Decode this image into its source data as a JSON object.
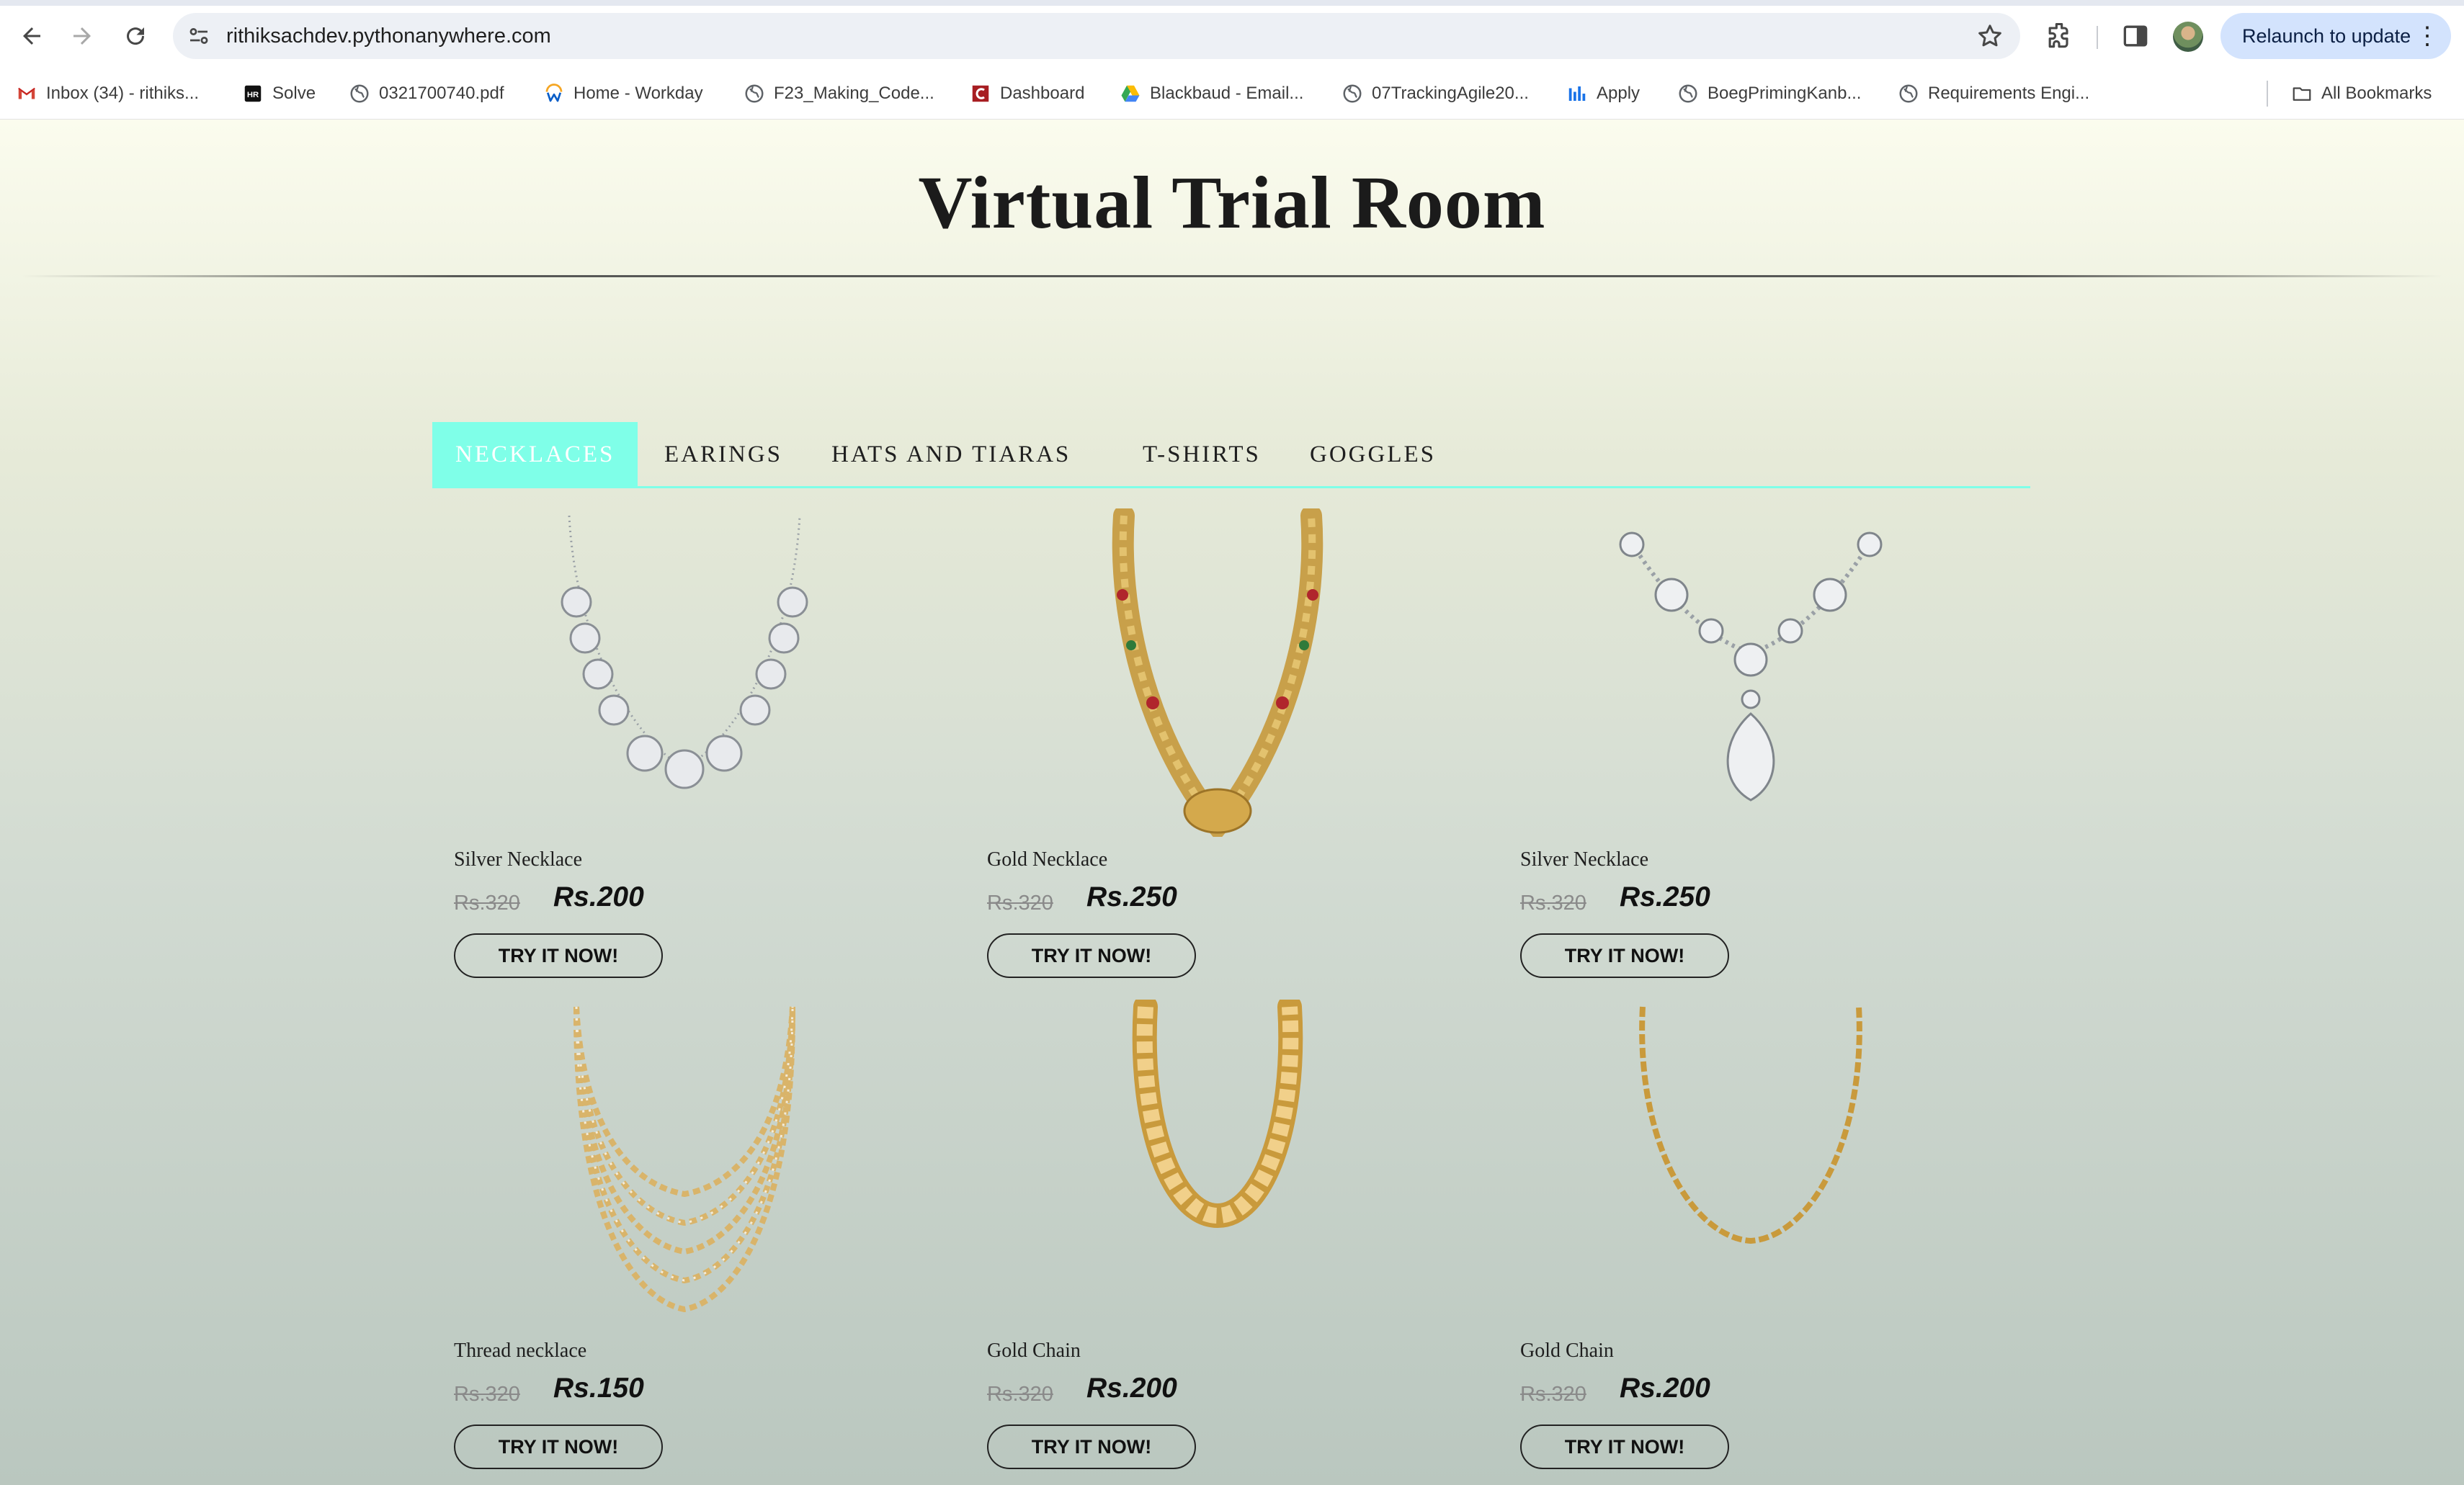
{
  "browser": {
    "url": "rithiksachdev.pythonanywhere.com",
    "relaunch_label": "Relaunch to update",
    "bookmarks": [
      {
        "label": "Inbox (34) - rithiks...",
        "icon": "gmail-icon"
      },
      {
        "label": "Solve",
        "icon": "solve-icon"
      },
      {
        "label": "0321700740.pdf",
        "icon": "globe-icon"
      },
      {
        "label": "Home - Workday",
        "icon": "workday-icon"
      },
      {
        "label": "F23_Making_Code...",
        "icon": "globe-icon"
      },
      {
        "label": "Dashboard",
        "icon": "dashboard-icon"
      },
      {
        "label": "Blackbaud - Email...",
        "icon": "drive-icon"
      },
      {
        "label": "07TrackingAgile20...",
        "icon": "globe-icon"
      },
      {
        "label": "Apply",
        "icon": "bar-chart-icon"
      },
      {
        "label": "BoegPrimingKanb...",
        "icon": "globe-icon"
      },
      {
        "label": "Requirements Engi...",
        "icon": "globe-icon"
      }
    ],
    "all_bookmarks_label": "All Bookmarks"
  },
  "page": {
    "title": "Virtual Trial Room",
    "tabs": [
      {
        "label": "NECKLACES",
        "active": true
      },
      {
        "label": "EARINGS",
        "active": false
      },
      {
        "label": "HATS AND TIARAS",
        "active": false
      },
      {
        "label": "T-SHIRTS",
        "active": false
      },
      {
        "label": "GOGGLES",
        "active": false
      }
    ],
    "products": [
      {
        "name": "Silver Necklace",
        "old_price": "Rs.320",
        "price": "Rs.200",
        "button": "TRY IT NOW!",
        "image": "silver-necklace-image"
      },
      {
        "name": "Gold Necklace",
        "old_price": "Rs.320",
        "price": "Rs.250",
        "button": "TRY IT NOW!",
        "image": "gold-necklace-image"
      },
      {
        "name": "Silver Necklace",
        "old_price": "Rs.320",
        "price": "Rs.250",
        "button": "TRY IT NOW!",
        "image": "diamond-pendant-necklace-image"
      },
      {
        "name": "Thread necklace",
        "old_price": "Rs.320",
        "price": "Rs.150",
        "button": "TRY IT NOW!",
        "image": "layered-thread-necklace-image"
      },
      {
        "name": "Gold Chain",
        "old_price": "Rs.320",
        "price": "Rs.200",
        "button": "TRY IT NOW!",
        "image": "cuban-gold-chain-image"
      },
      {
        "name": "Gold Chain",
        "old_price": "Rs.320",
        "price": "Rs.200",
        "button": "TRY IT NOW!",
        "image": "thin-gold-chain-image"
      }
    ]
  },
  "colors": {
    "tab_accent": "#7fffe8",
    "relaunch_bg": "#d3e3fd",
    "page_gradient_top": "#fbfcee",
    "page_gradient_bottom": "#bac7bf"
  }
}
